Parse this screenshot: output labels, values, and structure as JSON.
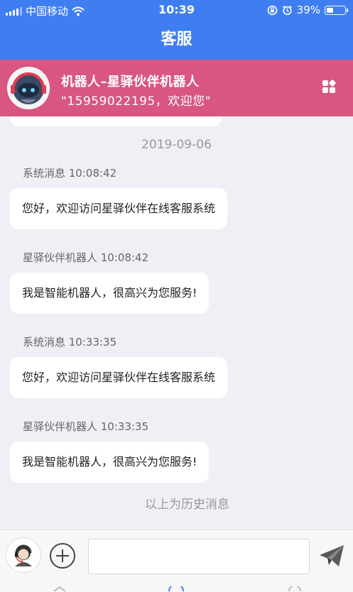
{
  "status_bar": {
    "carrier": "中国移动",
    "time": "10:39",
    "battery_percent": "39%",
    "battery_level": 0.39
  },
  "nav": {
    "title": "客服"
  },
  "robot": {
    "name": "机器人–星驿伙伴机器人",
    "greeting": "\"15959022195，欢迎您\""
  },
  "chat": {
    "date": "2019-09-06",
    "messages": [
      {
        "sender_time": "系统消息 10:08:42",
        "text": "您好，欢迎访问星驿伙伴在线客服系统"
      },
      {
        "sender_time": "星驿伙伴机器人 10:08:42",
        "text": "我是智能机器人，很高兴为您服务!"
      },
      {
        "sender_time": "系统消息 10:33:35",
        "text": "您好，欢迎访问星驿伙伴在线客服系统"
      },
      {
        "sender_time": "星驿伙伴机器人 10:33:35",
        "text": "我是智能机器人，很高兴为您服务!"
      }
    ],
    "history_note": "以上为历史消息"
  },
  "input": {
    "value": ""
  },
  "colors": {
    "nav": "#3f7ef0",
    "robot_header": "#d8567f",
    "background": "#eef0f5"
  }
}
